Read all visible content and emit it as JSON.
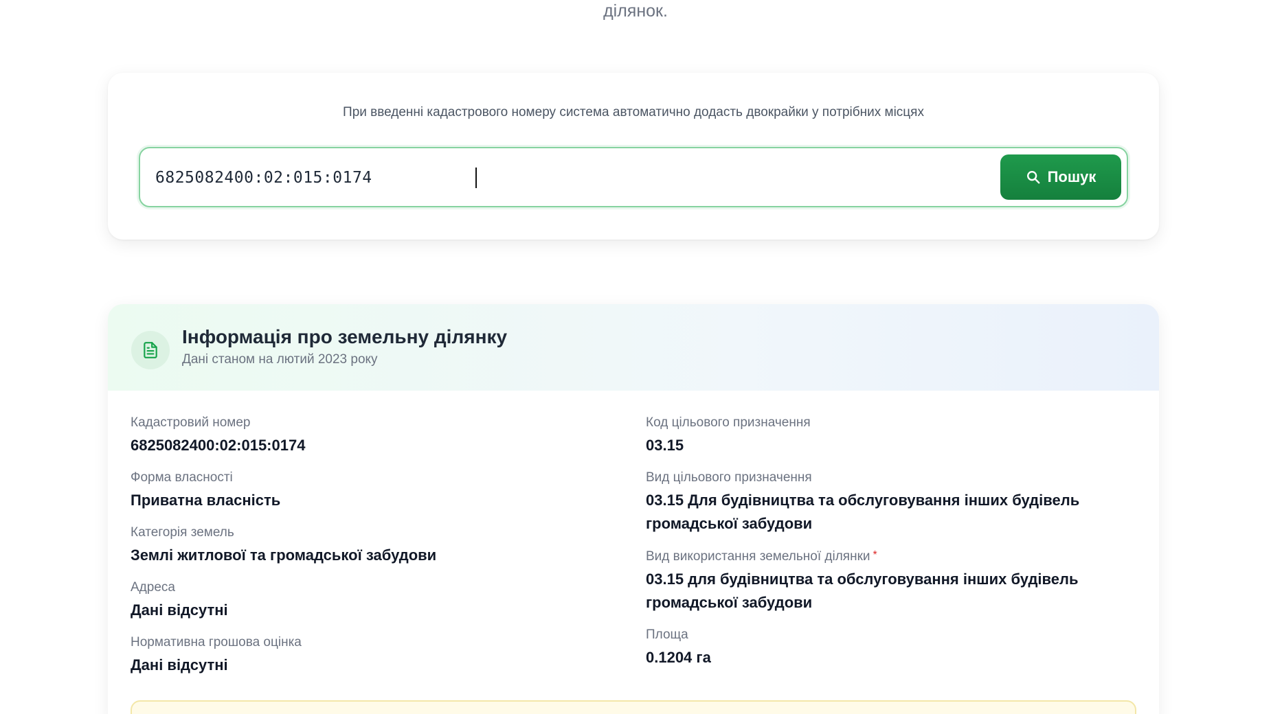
{
  "top_text": "ділянок.",
  "search": {
    "hint": "При введенні кадастрового номеру система автоматично додасть двокрайки у потрібних місцях",
    "value": "6825082400:02:015:0174",
    "button_label": "Пошук"
  },
  "info": {
    "title": "Інформація про земельну ділянку",
    "subtitle": "Дані станом на лютий 2023 року",
    "left_fields": [
      {
        "label": "Кадастровий номер",
        "value": "6825082400:02:015:0174"
      },
      {
        "label": "Форма власності",
        "value": "Приватна власність"
      },
      {
        "label": "Категорія земель",
        "value": "Землі житлової та громадської забудови"
      },
      {
        "label": "Адреса",
        "value": "Дані відсутні"
      },
      {
        "label": "Нормативна грошова оцінка",
        "value": "Дані відсутні"
      }
    ],
    "right_fields": [
      {
        "label": "Код цільового призначення",
        "value": "03.15"
      },
      {
        "label": "Вид цільового призначення",
        "value_line1": "03.15 Для будівництва та обслуговування інших будівель",
        "value_line2": "громадської забудови"
      },
      {
        "label": "Вид використання земельної ділянки",
        "required_mark": "*",
        "value_line1": "03.15 для будівництва та обслуговування інших будівель",
        "value_line2": "громадської забудови"
      },
      {
        "label": "Площа",
        "value": "0.1204 га"
      }
    ]
  },
  "colors": {
    "primary_green": "#15803d",
    "input_border": "#86d3a0",
    "required": "#dc2626"
  }
}
